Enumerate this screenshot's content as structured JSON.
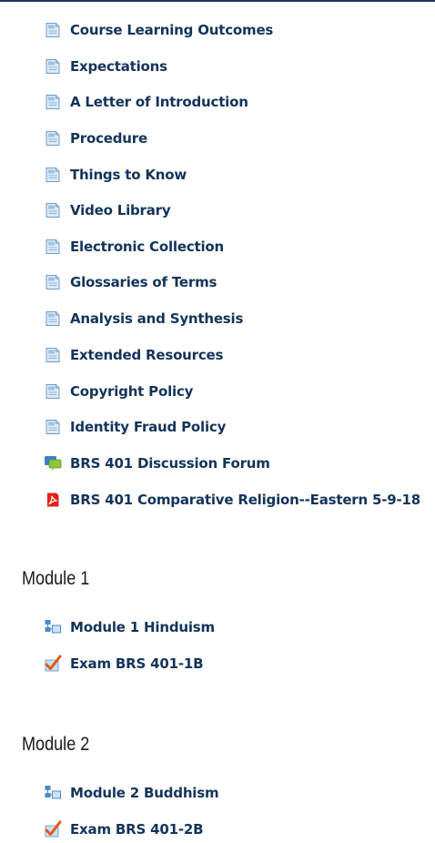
{
  "intro_items": [
    {
      "label": "Course Learning Outcomes",
      "icon": "page-icon"
    },
    {
      "label": "Expectations",
      "icon": "page-icon"
    },
    {
      "label": "A Letter of Introduction",
      "icon": "page-icon"
    },
    {
      "label": "Procedure",
      "icon": "page-icon"
    },
    {
      "label": "Things to Know",
      "icon": "page-icon"
    },
    {
      "label": "Video Library",
      "icon": "page-icon"
    },
    {
      "label": "Electronic Collection",
      "icon": "page-icon"
    },
    {
      "label": "Glossaries of Terms",
      "icon": "page-icon"
    },
    {
      "label": "Analysis and Synthesis",
      "icon": "page-icon"
    },
    {
      "label": "Extended Resources",
      "icon": "page-icon"
    },
    {
      "label": "Copyright Policy",
      "icon": "page-icon"
    },
    {
      "label": "Identity Fraud Policy",
      "icon": "page-icon"
    },
    {
      "label": "BRS 401 Discussion Forum",
      "icon": "forum-icon"
    },
    {
      "label": "BRS 401 Comparative Religion--Eastern 5-9-18",
      "icon": "pdf-icon"
    }
  ],
  "modules": [
    {
      "title": "Module 1",
      "items": [
        {
          "label": "Module 1 Hinduism",
          "icon": "book-icon"
        },
        {
          "label": "Exam BRS 401-1B",
          "icon": "quiz-icon"
        }
      ]
    },
    {
      "title": "Module 2",
      "items": [
        {
          "label": "Module 2 Buddhism",
          "icon": "book-icon"
        },
        {
          "label": "Exam BRS 401-2B",
          "icon": "quiz-icon"
        }
      ]
    }
  ],
  "colors": {
    "link": "#13345a",
    "heading": "#1a1a1a",
    "top_rule": "#1b3a5b"
  }
}
